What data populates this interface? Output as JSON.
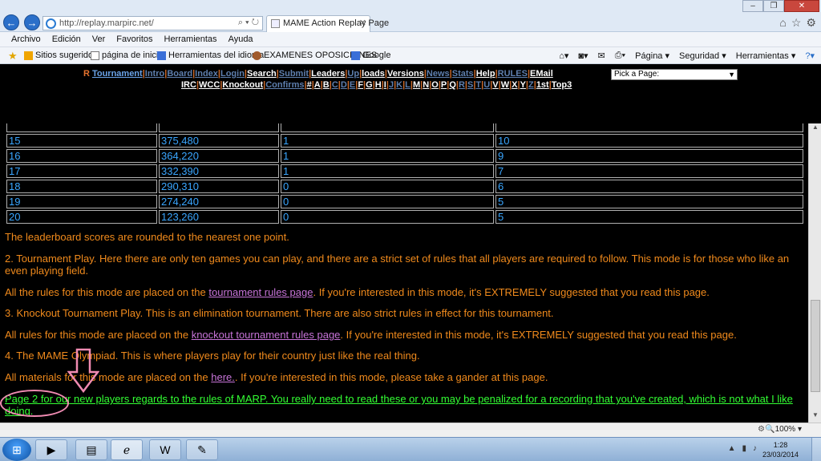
{
  "browser": {
    "url": "http://replay.marpirc.net/",
    "tab_title": "MAME Action Replay Page",
    "window_buttons": [
      "–",
      "❐",
      "✕"
    ],
    "menu": [
      "Archivo",
      "Edición",
      "Ver",
      "Favoritos",
      "Herramientas",
      "Ayuda"
    ],
    "favorites": [
      "Sitios sugeridos",
      "página de inicio",
      "Herramientas del idioma",
      "EXAMENES OPOSICIONES",
      "Google"
    ],
    "command_bar": [
      "Página",
      "Seguridad",
      "Herramientas"
    ],
    "zoom": "100%"
  },
  "site_nav": {
    "prefix": "R",
    "row1": [
      {
        "label": "Tournament",
        "style": "hl"
      },
      {
        "label": "Intro",
        "style": "dim"
      },
      {
        "label": "Board",
        "style": "dim"
      },
      {
        "label": "Index",
        "style": "dim"
      },
      {
        "label": "Login",
        "style": "dim"
      },
      {
        "label": "Search",
        "style": "normal"
      },
      {
        "label": "Submit",
        "style": "dim"
      },
      {
        "label": "Leaders",
        "style": "normal"
      },
      {
        "label": "Up",
        "style": "dim"
      },
      {
        "label": "loads",
        "style": "normal"
      },
      {
        "label": "Versions",
        "style": "normal"
      },
      {
        "label": "News",
        "style": "dim"
      },
      {
        "label": "Stats",
        "style": "dim"
      },
      {
        "label": "Help",
        "style": "normal"
      },
      {
        "label": "RULES",
        "style": "dim"
      },
      {
        "label": "EMail",
        "style": "normal"
      }
    ],
    "row2": [
      "IRC",
      "WCC",
      "Knockout",
      "Confirms",
      "#",
      "A",
      "B",
      "C",
      "D",
      "E",
      "F",
      "G",
      "H",
      "I",
      "J",
      "K",
      "L",
      "M",
      "N",
      "O",
      "P",
      "Q",
      "R",
      "S",
      "T",
      "U",
      "V",
      "W",
      "X",
      "Y",
      "Z",
      "1st",
      "Top3"
    ],
    "row2_dim": [
      "Confirms",
      "C",
      "D",
      "E",
      "J",
      "K",
      "L",
      "R",
      "S",
      "T",
      "U",
      "Z"
    ],
    "select_placeholder": "Pick a Page:"
  },
  "leaderboard": {
    "rows": [
      [
        "",
        "",
        "",
        ""
      ],
      [
        "15",
        "375,480",
        "1",
        "10"
      ],
      [
        "16",
        "364,220",
        "1",
        "9"
      ],
      [
        "17",
        "332,390",
        "1",
        "7"
      ],
      [
        "18",
        "290,310",
        "0",
        "6"
      ],
      [
        "19",
        "274,240",
        "0",
        "5"
      ],
      [
        "20",
        "123,260",
        "0",
        "5"
      ]
    ]
  },
  "content": {
    "p_rounded": "The leaderboard scores are rounded to the nearest one point.",
    "p_tournament": "2.  Tournament Play.  Here there are only ten games you can play, and there are a strict set of rules that all players are required to follow.  This mode is for those who like an even playing field.",
    "p_rules_before": "All the rules for this mode are placed on the ",
    "p_rules_link": "tournament rules page",
    "p_rules_after": ".  If you're interested in this mode, it's EXTREMELY suggested that you read this page.",
    "p_knockout": "3.  Knockout Tournament Play.  This is an elimination tournament.  There are also strict rules in effect for this tournament.",
    "p_ko_before": "All rules for this mode are placed on the ",
    "p_ko_link": "knockout tournament rules page",
    "p_ko_after": ".  If you're interested in this mode, it's EXTREMELY suggested that you read this page.",
    "p_olympiad": "4.  The MAME Olympiad.  This is where players play for their country just like the real thing.",
    "p_mat_before": "All materials for this mode are placed on the ",
    "p_mat_link": "here.",
    "p_mat_after": ".  If you're interested in this mode, please take a gander at this page.",
    "p_page2": "Page 2 for our new players regards to the rules of MARP.  You really need to read these or you may be penalized for a recording that you've created, which is not what I like doing."
  },
  "taskbar": {
    "time": "1:28",
    "date": "23/03/2014"
  },
  "colors": {
    "page_bg": "#000000",
    "body_text": "#f08a1c",
    "link": "#c774d8",
    "table_text": "#3aa6ff",
    "highlight_text": "#33ff33",
    "annotation": "#f08bb2"
  }
}
